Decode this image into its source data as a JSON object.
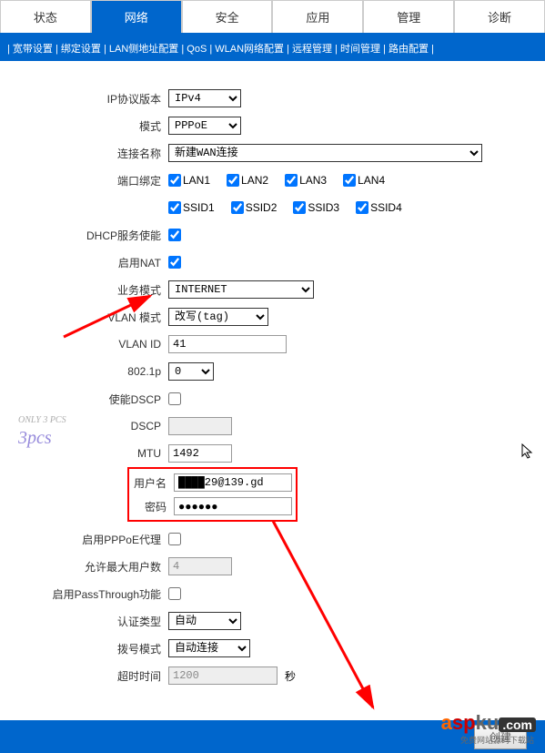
{
  "tabs": {
    "status": "状态",
    "network": "网络",
    "security": "安全",
    "application": "应用",
    "management": "管理",
    "diagnosis": "诊断"
  },
  "subnav": {
    "items": [
      "宽带设置",
      "绑定设置",
      "LAN侧地址配置",
      "QoS",
      "WLAN网络配置",
      "远程管理",
      "时间管理",
      "路由配置"
    ]
  },
  "form": {
    "ip_protocol_label": "IP协议版本",
    "ip_protocol_value": "IPv4",
    "mode_label": "模式",
    "mode_value": "PPPoE",
    "conn_name_label": "连接名称",
    "conn_name_value": "新建WAN连接",
    "port_bind_label": "端口绑定",
    "ports_lan": [
      "LAN1",
      "LAN2",
      "LAN3",
      "LAN4"
    ],
    "ports_ssid": [
      "SSID1",
      "SSID2",
      "SSID3",
      "SSID4"
    ],
    "dhcp_label": "DHCP服务使能",
    "nat_label": "启用NAT",
    "service_mode_label": "业务模式",
    "service_mode_value": "INTERNET",
    "vlan_mode_label": "VLAN 模式",
    "vlan_mode_value": "改写(tag)",
    "vlan_id_label": "VLAN ID",
    "vlan_id_value": "41",
    "p8021_label": "802.1p",
    "p8021_value": "0",
    "dscp_enable_label": "使能DSCP",
    "dscp_label": "DSCP",
    "dscp_value": "",
    "mtu_label": "MTU",
    "mtu_value": "1492",
    "username_label": "用户名",
    "username_value": "████29@139.gd",
    "password_label": "密码",
    "password_value": "●●●●●●",
    "pppoe_proxy_label": "启用PPPoE代理",
    "max_users_label": "允许最大用户数",
    "max_users_value": "4",
    "passthrough_label": "启用PassThrough功能",
    "auth_type_label": "认证类型",
    "auth_type_value": "自动",
    "dial_mode_label": "拨号模式",
    "dial_mode_value": "自动连接",
    "timeout_label": "超时时间",
    "timeout_value": "1200",
    "timeout_unit": "秒"
  },
  "footer": {
    "button": "创建"
  },
  "watermark": {
    "text": "3pcs",
    "small": "ONLY 3 PCS"
  },
  "logo": {
    "text": "aspku",
    "domain": ".com",
    "sub": "免费网站源码下载站"
  }
}
